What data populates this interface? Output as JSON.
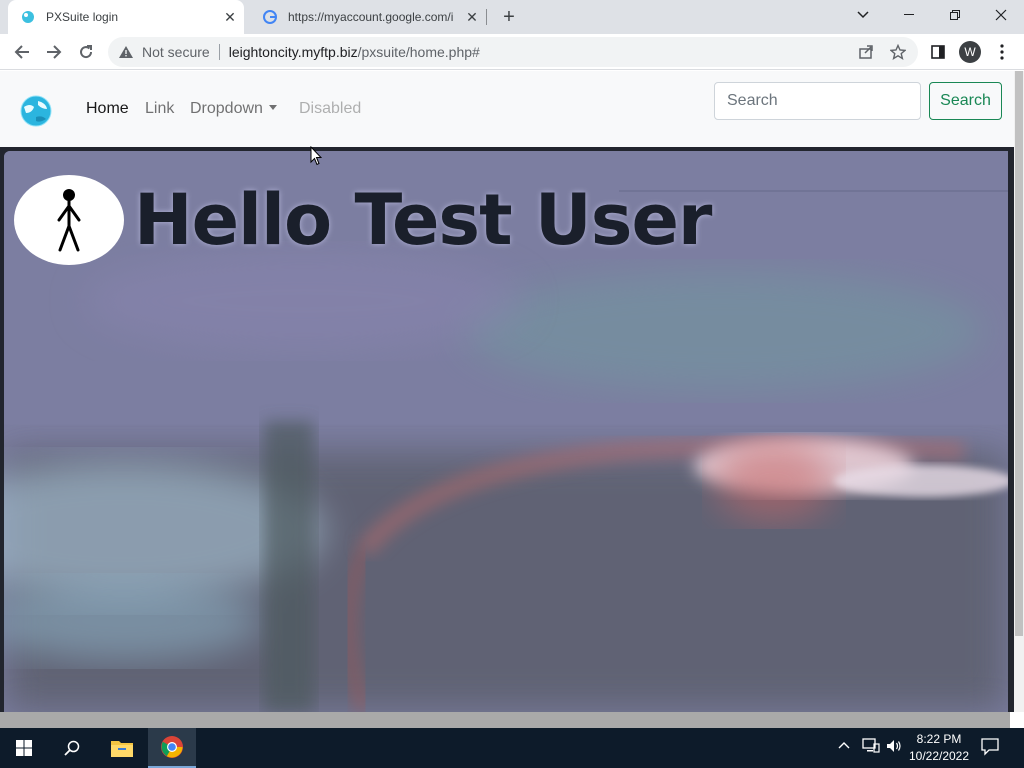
{
  "browser": {
    "tabs": [
      {
        "title": "PXSuite login",
        "active": true
      },
      {
        "title": "https://myaccount.google.com/i",
        "active": false
      }
    ],
    "new_tab_symbol": "+",
    "address": {
      "security_label": "Not secure",
      "host": "leightoncity.myftp.biz",
      "path": "/pxsuite/home.php#"
    },
    "profile_initial": "W"
  },
  "page": {
    "navbar": {
      "links": {
        "home": "Home",
        "link": "Link",
        "dropdown": "Dropdown",
        "disabled": "Disabled"
      },
      "search_placeholder": "Search",
      "search_button": "Search"
    },
    "hero": {
      "greeting": "Hello Test User"
    }
  },
  "taskbar": {
    "time": "8:22 PM",
    "date": "10/22/2022"
  },
  "colors": {
    "success": "#198754",
    "navbar_bg": "#f8f9fa",
    "taskbar_bg": "#0d1b2a"
  }
}
